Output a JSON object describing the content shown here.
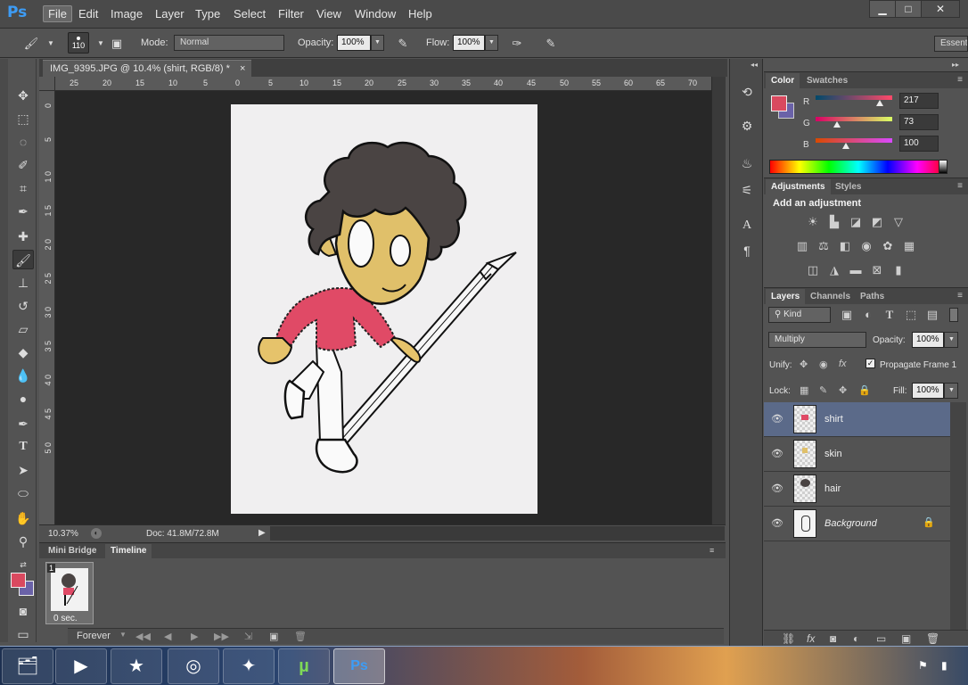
{
  "app": {
    "logo": "Ps"
  },
  "menu": [
    "File",
    "Edit",
    "Image",
    "Layer",
    "Type",
    "Select",
    "Filter",
    "View",
    "Window",
    "Help"
  ],
  "window_controls": {
    "minimize": "▁",
    "maximize": "□",
    "close": "✕"
  },
  "options": {
    "brush_size": "110",
    "mode_label": "Mode:",
    "mode_value": "Normal",
    "opacity_label": "Opacity:",
    "opacity_value": "100%",
    "flow_label": "Flow:",
    "flow_value": "100%",
    "workspace": "Essentials"
  },
  "document": {
    "tab_title": "IMG_9395.JPG @ 10.4% (shirt, RGB/8) *",
    "close": "×",
    "ruler_h": [
      "25",
      "20",
      "15",
      "10",
      "5",
      "0",
      "5",
      "10",
      "15",
      "20",
      "25",
      "30",
      "35",
      "40",
      "45",
      "50",
      "55",
      "60",
      "65",
      "70"
    ],
    "ruler_v": [
      "0",
      "5",
      "1 0",
      "1 5",
      "2 0",
      "2 5",
      "3 0",
      "3 5",
      "4 0",
      "4 5",
      "5 0"
    ],
    "zoom": "10.37%",
    "doc_size": "Doc: 41.8M/72.8M"
  },
  "timeline": {
    "tabs": [
      "Mini Bridge",
      "Timeline"
    ],
    "frame_number": "1",
    "frame_time": "0 sec.",
    "loop": "Forever"
  },
  "color_panel": {
    "tabs": [
      "Color",
      "Swatches"
    ],
    "r_label": "R",
    "r_value": "217",
    "g_label": "G",
    "g_value": "73",
    "b_label": "B",
    "b_value": "100",
    "foreground": "#d9495f",
    "background": "#6a62a8"
  },
  "adjustments_panel": {
    "tabs": [
      "Adjustments",
      "Styles"
    ],
    "title": "Add an adjustment"
  },
  "layers_panel": {
    "tabs": [
      "Layers",
      "Channels",
      "Paths"
    ],
    "filter_kind": "Kind",
    "blend_mode": "Multiply",
    "opacity_label": "Opacity:",
    "opacity_value": "100%",
    "unify_label": "Unify:",
    "propagate_label": "Propagate Frame 1",
    "lock_label": "Lock:",
    "fill_label": "Fill:",
    "fill_value": "100%",
    "layers": [
      {
        "name": "shirt",
        "selected": true
      },
      {
        "name": "skin",
        "selected": false
      },
      {
        "name": "hair",
        "selected": false
      },
      {
        "name": "Background",
        "selected": false,
        "locked": true
      }
    ]
  },
  "taskbar": [
    "file-explorer-icon",
    "media-player-icon",
    "favorites-icon",
    "chrome-icon",
    "app-star-icon",
    "utorrent-icon",
    "photoshop-icon"
  ]
}
